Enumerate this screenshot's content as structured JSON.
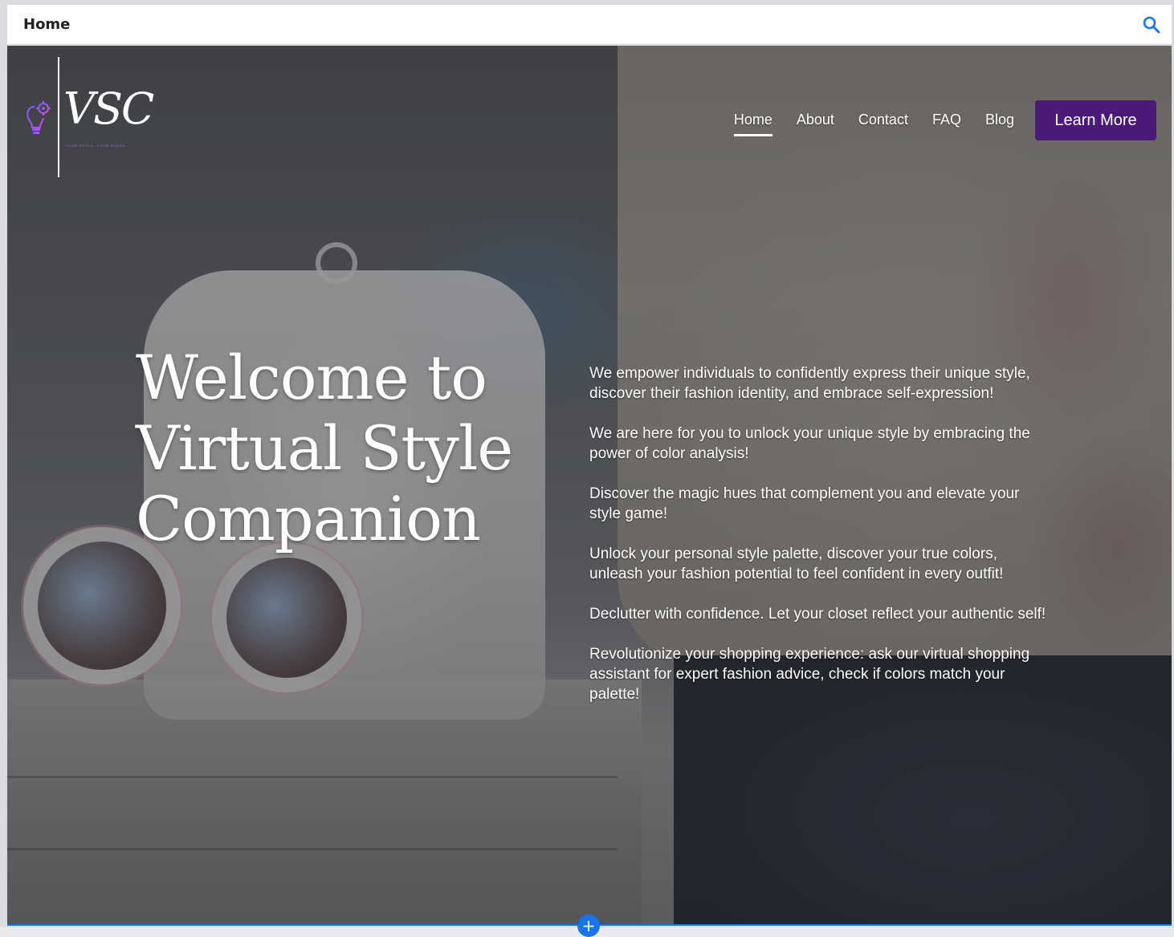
{
  "editor": {
    "page_name": "Home",
    "search_icon": "search-icon"
  },
  "site": {
    "logo_monogram": "VSC",
    "logo_tagline": "YOUR STYLE, YOUR RULES",
    "nav": [
      {
        "label": "Home",
        "active": true
      },
      {
        "label": "About",
        "active": false
      },
      {
        "label": "Contact",
        "active": false
      },
      {
        "label": "FAQ",
        "active": false
      },
      {
        "label": "Blog",
        "active": false
      }
    ],
    "cta_label": "Learn More",
    "cta_color": "#4b1a78"
  },
  "hero": {
    "headline": "Welcome to Virtual Style Companion",
    "paragraphs": [
      "We empower individuals to confidently express their unique style, discover their fashion identity, and embrace self-expression!",
      "We are here for you to unlock your unique style by  embracing the power of color analysis!",
      "Discover the magic hues that complement you and elevate your style game!",
      "Unlock your personal style palette,  discover your true colors, unleash your fashion potential to feel confident in every outfit!",
      "Declutter with confidence. Let your closet reflect your authentic self!",
      "Revolutionize your shopping experience: ask our virtual shopping assistant for expert fashion advice, check if colors match your palette!"
    ]
  },
  "editor_controls": {
    "add_section_label": "+",
    "accent": "#1a73e8"
  }
}
